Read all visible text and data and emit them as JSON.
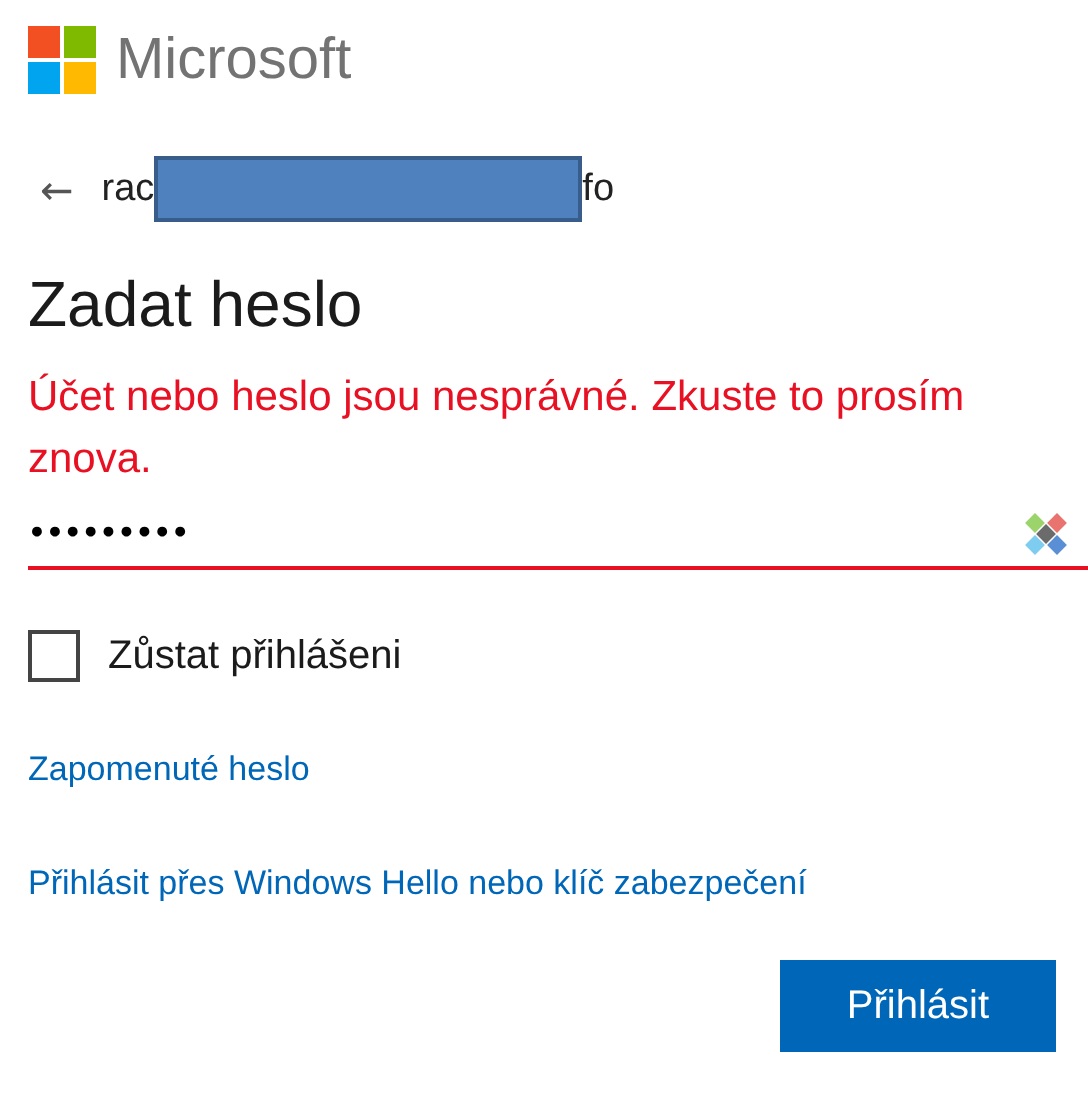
{
  "brand": {
    "name": "Microsoft"
  },
  "account": {
    "back": "←",
    "email_start": "rac",
    "email_end": "fo",
    "redacted": true
  },
  "title": "Zadat heslo",
  "error": "Účet nebo heslo jsou nesprávné. Zkuste to prosím znova.",
  "password": {
    "value": "•••••••••",
    "invalid": true
  },
  "keep_signed_in": {
    "label": "Zůstat přihlášeni",
    "checked": false
  },
  "links": [
    "Zapomenuté heslo",
    "Přihlásit přes Windows Hello nebo klíč zabezpečení"
  ],
  "buttons": [
    {
      "label": "Přihlásit",
      "kind": "primary"
    }
  ]
}
